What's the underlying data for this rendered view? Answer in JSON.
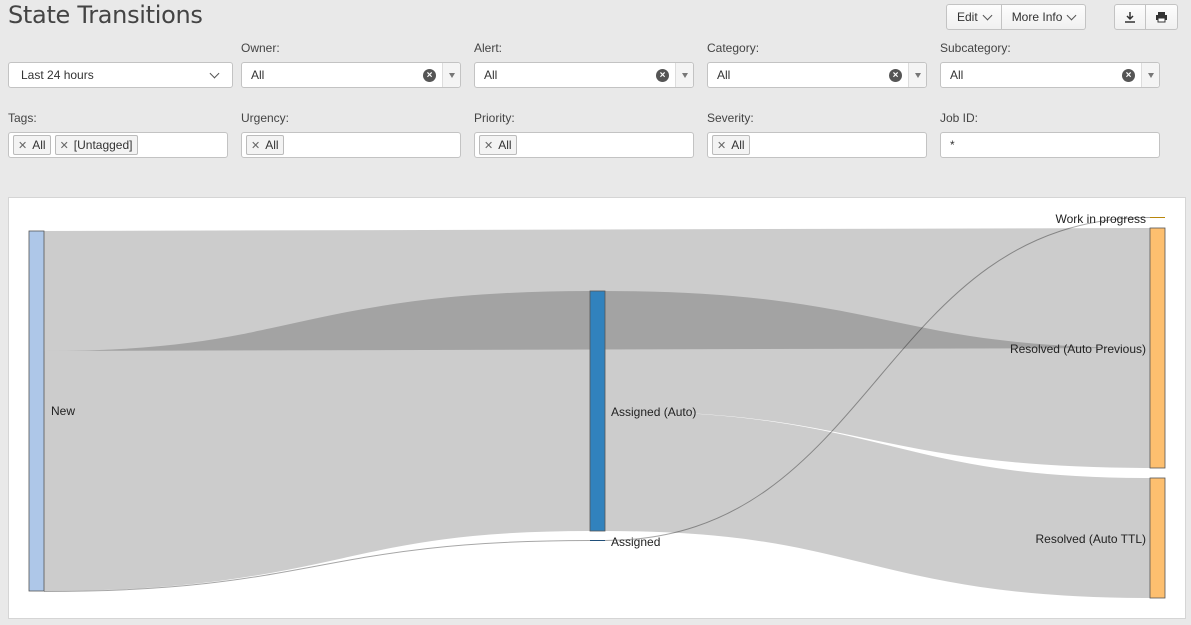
{
  "title": "State Transitions",
  "toolbar": {
    "edit_label": "Edit",
    "more_info_label": "More Info",
    "download_icon": "download-icon",
    "print_icon": "print-icon"
  },
  "filters": {
    "time": {
      "value": "Last 24 hours"
    },
    "owner": {
      "label": "Owner:",
      "value": "All"
    },
    "alert": {
      "label": "Alert:",
      "value": "All"
    },
    "category": {
      "label": "Category:",
      "value": "All"
    },
    "subcategory": {
      "label": "Subcategory:",
      "value": "All"
    },
    "tags": {
      "label": "Tags:",
      "tokens": [
        "All",
        "[Untagged]"
      ]
    },
    "urgency": {
      "label": "Urgency:",
      "tokens": [
        "All"
      ]
    },
    "priority": {
      "label": "Priority:",
      "tokens": [
        "All"
      ]
    },
    "severity": {
      "label": "Severity:",
      "tokens": [
        "All"
      ]
    },
    "job_id": {
      "label": "Job ID:",
      "value": "*"
    }
  },
  "chart_data": {
    "type": "sankey",
    "nodes": [
      {
        "id": "new",
        "label": "New",
        "color": "#aec7e8"
      },
      {
        "id": "assigned_auto",
        "label": "Assigned (Auto)",
        "color": "#3182bd"
      },
      {
        "id": "assigned",
        "label": "Assigned",
        "color": "#3182bd"
      },
      {
        "id": "work_in_progress",
        "label": "Work in progress",
        "color": "#fdae6b"
      },
      {
        "id": "resolved_auto_previous",
        "label": "Resolved (Auto Previous)",
        "color": "#fdbf6f"
      },
      {
        "id": "resolved_auto_ttl",
        "label": "Resolved (Auto TTL)",
        "color": "#fdbf6f"
      }
    ],
    "links": [
      {
        "source": "new",
        "target": "resolved_auto_previous",
        "value": 120
      },
      {
        "source": "new",
        "target": "assigned_auto",
        "value": 240
      },
      {
        "source": "new",
        "target": "assigned",
        "value": 1
      },
      {
        "source": "assigned_auto",
        "target": "resolved_auto_previous",
        "value": 120
      },
      {
        "source": "assigned_auto",
        "target": "resolved_auto_ttl",
        "value": 120
      },
      {
        "source": "assigned",
        "target": "work_in_progress",
        "value": 1
      }
    ]
  }
}
